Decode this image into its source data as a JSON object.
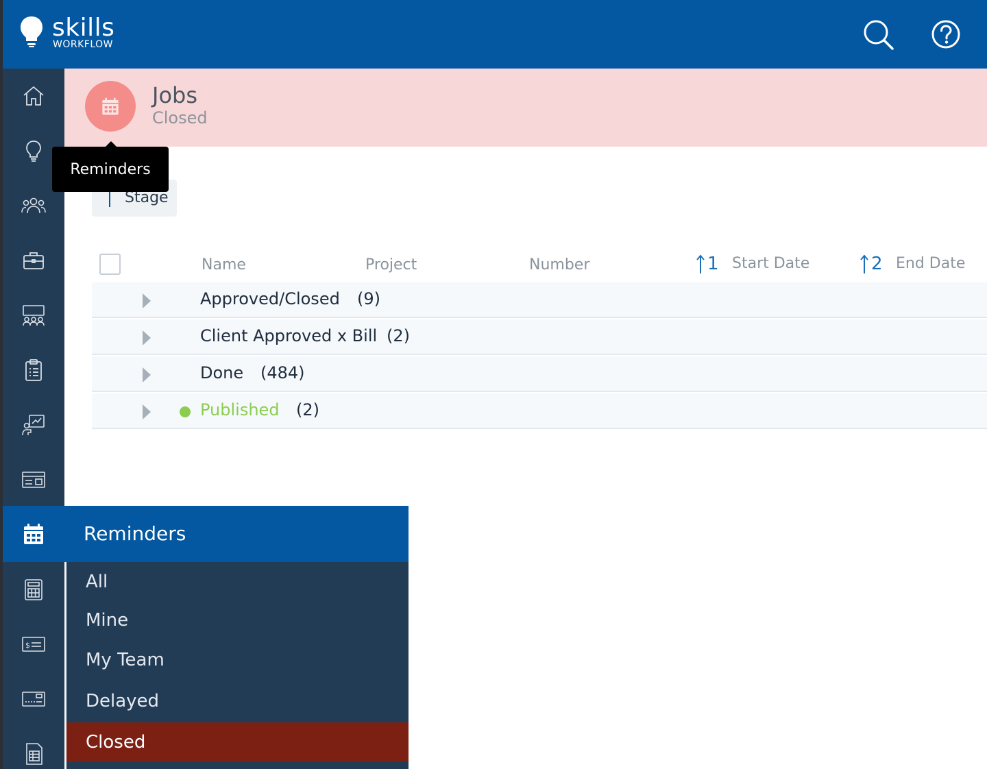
{
  "header": {
    "logo_name": "skills",
    "logo_sub": "WORKFLOW"
  },
  "sidebar": {
    "items": [
      {
        "icon": "home-icon"
      },
      {
        "icon": "lightbulb-icon"
      },
      {
        "icon": "team-icon"
      },
      {
        "icon": "briefcase-icon"
      },
      {
        "icon": "board-icon"
      },
      {
        "icon": "clipboard-icon"
      },
      {
        "icon": "presentation-icon"
      },
      {
        "icon": "card-icon"
      },
      {
        "icon": "calendar-icon"
      },
      {
        "icon": "calculator-icon"
      },
      {
        "icon": "invoice-icon"
      },
      {
        "icon": "payment-icon"
      },
      {
        "icon": "spreadsheet-icon"
      }
    ]
  },
  "page": {
    "title": "Jobs",
    "subtitle": "Closed"
  },
  "tooltip": {
    "text": "Reminders"
  },
  "grouping": {
    "chip_label": "Stage"
  },
  "table": {
    "columns": {
      "name": "Name",
      "project": "Project",
      "number": "Number",
      "start_sort": "1",
      "start_date": "Start Date",
      "end_sort": "2",
      "end_date": "End Date"
    },
    "groups": [
      {
        "name": "Approved/Closed",
        "count": "(9)"
      },
      {
        "name": "Client Approved x Bill",
        "count": "(2)"
      },
      {
        "name": "Done",
        "count": "(484)"
      },
      {
        "name": "Published",
        "count": "(2)",
        "status_color": "#8ccd4f"
      }
    ]
  },
  "reminders_menu": {
    "title": "Reminders",
    "items": [
      "All",
      "Mine",
      "My Team",
      "Delayed",
      "Closed"
    ],
    "selected": "Closed"
  },
  "colors": {
    "brand_blue": "#0358a1",
    "sidebar_navy": "#233c55",
    "header_pink": "#f8d7d8",
    "avatar_coral": "#f48c89",
    "selected_red": "#7d2014",
    "published_green": "#8ccd4f"
  }
}
